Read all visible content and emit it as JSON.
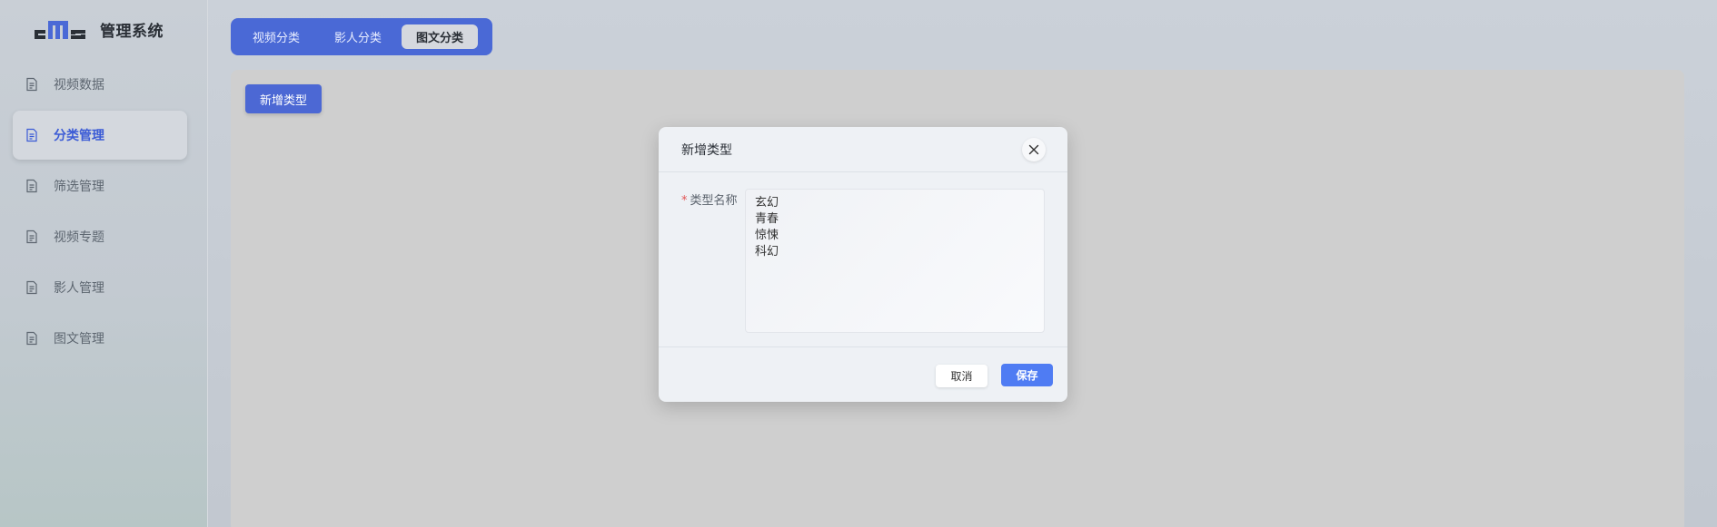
{
  "app": {
    "title": "管理系统",
    "logo_text": "cms"
  },
  "sidebar": {
    "items": [
      {
        "label": "视频数据",
        "icon": "document-icon",
        "active": false
      },
      {
        "label": "分类管理",
        "icon": "document-icon",
        "active": true
      },
      {
        "label": "筛选管理",
        "icon": "document-icon",
        "active": false
      },
      {
        "label": "视频专题",
        "icon": "document-icon",
        "active": false
      },
      {
        "label": "影人管理",
        "icon": "document-icon",
        "active": false
      },
      {
        "label": "图文管理",
        "icon": "document-icon",
        "active": false
      }
    ]
  },
  "tabs": [
    {
      "label": "视频分类",
      "active": false
    },
    {
      "label": "影人分类",
      "active": false
    },
    {
      "label": "图文分类",
      "active": true
    }
  ],
  "main": {
    "add_button_label": "新增类型"
  },
  "modal": {
    "title": "新增类型",
    "field_label": "类型名称",
    "required_mark": "*",
    "field_value": "玄幻\n青春\n惊悚\n科幻",
    "cancel_label": "取消",
    "save_label": "保存"
  },
  "colors": {
    "accent": "#4a69d6",
    "primary_button": "#4f7cf3",
    "required": "#e25555"
  }
}
